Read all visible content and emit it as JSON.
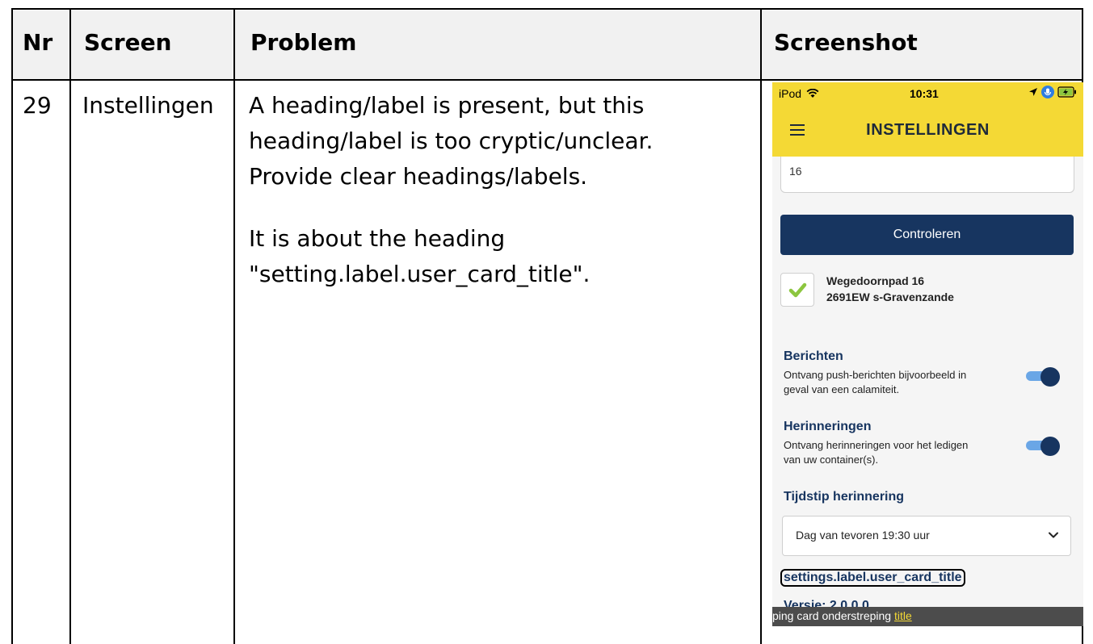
{
  "table": {
    "headers": {
      "nr": "Nr",
      "screen": "Screen",
      "problem": "Problem",
      "screenshot": "Screenshot"
    },
    "row": {
      "nr": "29",
      "screen": "Instellingen",
      "problem_line1": "A heading/label is present, but this",
      "problem_line2": "heading/label is too cryptic/unclear.",
      "problem_line3": "Provide clear headings/labels.",
      "problem_line4": "It is about the heading",
      "problem_line5": "\"setting.label.user_card_title\"."
    }
  },
  "phone": {
    "status": {
      "carrier": "iPod",
      "time": "10:31"
    },
    "title": "INSTELLINGEN",
    "input_value": "16",
    "check_button": "Controleren",
    "address_line1": "Wegedoornpad 16",
    "address_line2": "2691EW s-Gravenzande",
    "berichten": {
      "title": "Berichten",
      "desc_line1": "Ontvang push-berichten bijvoorbeeld in",
      "desc_line2": "geval van een calamiteit.",
      "enabled": true
    },
    "herinneringen": {
      "title": "Herinneringen",
      "desc_line1": "Ontvang herinneringen voor het ledigen",
      "desc_line2": "van uw container(s).",
      "enabled": true
    },
    "tijdstip_title": "Tijdstip herinnering",
    "tijdstip_value": "Dag van tevoren 19:30 uur",
    "user_card_title": "settings.label.user_card_title",
    "versie": "Versie: 2.0.0.0",
    "tooltip_text": "ping card onderstreping ",
    "tooltip_highlight": "title"
  },
  "colors": {
    "header_bg": "#f1f1f1",
    "app_bar": "#f4d935",
    "primary": "#173560",
    "toggle_track": "#6aa6e6",
    "check": "#8cc63f"
  }
}
